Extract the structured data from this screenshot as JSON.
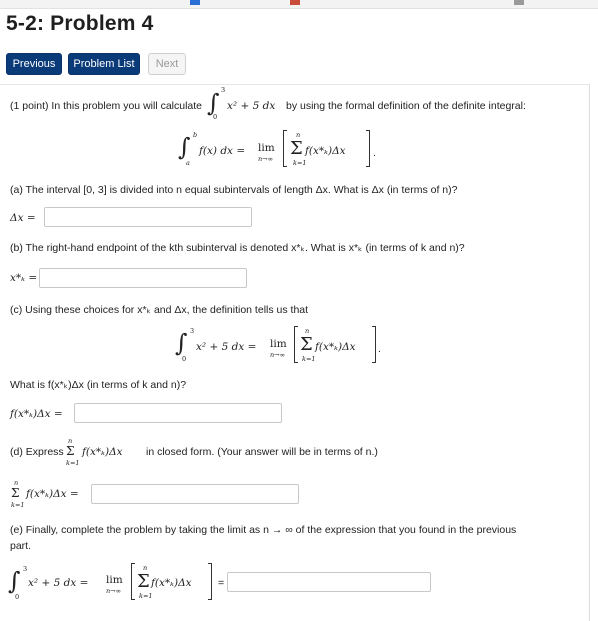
{
  "page": {
    "title": "5-2: Problem 4"
  },
  "nav": {
    "previous": "Previous",
    "problem_list": "Problem List",
    "next": "Next"
  },
  "intro": {
    "prefix": "(1 point) In this problem you will calculate",
    "upper": "3",
    "lower": "0",
    "integrand": "x² + 5 dx",
    "suffix": "by using the formal definition of the definite integral:"
  },
  "definition": {
    "lhs_upper": "b",
    "lhs_lower": "a",
    "lhs": "f(x) dx =",
    "lim": "lim",
    "lim_sub": "n→∞",
    "sum_top": "n",
    "sum_bottom": "k=1",
    "sum_body": "f(x*ₖ)Δx"
  },
  "part_a": {
    "text": "(a) The interval [0, 3] is divided into n equal subintervals of length Δx. What is Δx (in terms of n)?",
    "label": "Δx =",
    "value": ""
  },
  "part_b": {
    "text": "(b) The right-hand endpoint of the kth subinterval is denoted x*ₖ. What is x*ₖ (in terms of k and n)?",
    "label": "x*ₖ =",
    "value": ""
  },
  "part_c": {
    "text": "(c) Using these choices for x*ₖ and Δx, the definition tells us that",
    "eq_upper": "3",
    "eq_lower": "0",
    "eq_lhs": "x² + 5 dx =",
    "lim": "lim",
    "lim_sub": "n→∞",
    "sum_top": "n",
    "sum_bottom": "k=1",
    "sum_body": "f(x*ₖ)Δx",
    "question": "What is f(x*ₖ)Δx (in terms of k and n)?",
    "label": "f(x*ₖ)Δx =",
    "value": ""
  },
  "part_d": {
    "prefix": "(d) Express",
    "sum_top": "n",
    "sum_bottom": "k=1",
    "sum_body": "f(x*ₖ)Δx",
    "suffix": "in closed form. (Your answer will be in terms of n.)",
    "label_body": "f(x*ₖ)Δx =",
    "value": ""
  },
  "part_e": {
    "text_line1": "(e) Finally, complete the problem by taking the limit as n → ∞ of the expression that you found in the previous",
    "text_line2": "part.",
    "eq_upper": "3",
    "eq_lower": "0",
    "eq_lhs": "x² + 5 dx =",
    "lim": "lim",
    "lim_sub": "n→∞",
    "sum_top": "n",
    "sum_bottom": "k=1",
    "sum_body": "f(x*ₖ)Δx",
    "equals": "=",
    "value": ""
  }
}
